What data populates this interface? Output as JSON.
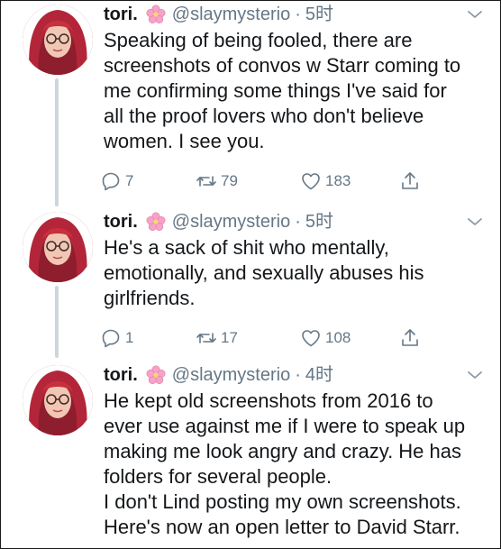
{
  "tweets": [
    {
      "name": "tori.",
      "handle": "@slaymysterio",
      "separator": "·",
      "time": "5时",
      "text": "Speaking of being fooled, there are\nscreenshots of convos w Starr coming to\nme confirming some things I've said for\nall the proof lovers who don't believe\nwomen. I see you.",
      "replies": "7",
      "retweets": "79",
      "likes": "183"
    },
    {
      "name": "tori.",
      "handle": "@slaymysterio",
      "separator": "·",
      "time": "5时",
      "text": "He's a sack of shit who mentally,\nemotionally, and sexually abuses his\ngirlfriends.",
      "replies": "1",
      "retweets": "17",
      "likes": "108"
    },
    {
      "name": "tori.",
      "handle": "@slaymysterio",
      "separator": "·",
      "time": "4时",
      "text": "He kept old screenshots from 2016 to\never use against me if I were to speak up\nmaking me look angry and crazy. He has\nfolders for several people.\nI don't Lind posting my own screenshots.\nHere's now an open letter to David Starr.",
      "replies": "",
      "retweets": "",
      "likes": ""
    }
  ],
  "icons": {
    "reply": "reply-icon",
    "retweet": "retweet-icon",
    "like": "heart-icon",
    "share": "share-icon",
    "more": "chevron-down-icon",
    "emoji": "cherry-blossom-icon"
  },
  "colors": {
    "text": "#14171a",
    "muted": "#657786",
    "thread_line": "#ccd6dd",
    "flower": "#f5a3c7"
  }
}
